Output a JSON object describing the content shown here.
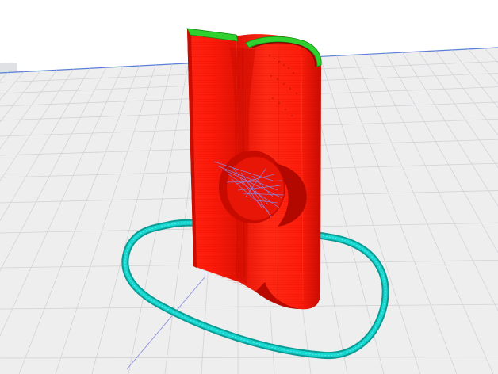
{
  "viewport": {
    "description_label": "",
    "colors": {
      "background": "#ffffff",
      "build_plate": "#eeeeef",
      "grid_line": "#d2d3d6",
      "plate_edge": "#5a7fd6",
      "axis_line": "#8a90e0",
      "model_wall": "#ff1a0a",
      "model_shadow": "#d40e00",
      "model_highlight": "#ff4a36",
      "top_layer": "#2ed12e",
      "travel_moves": "#8a8ff0",
      "skirt": "#16d7cf",
      "skirt_dark": "#0c9a94"
    },
    "objects": [
      {
        "name": "build-plate",
        "kind": "grid"
      },
      {
        "name": "skirt-outline",
        "kind": "brim"
      },
      {
        "name": "sliced-model",
        "kind": "layer-preview"
      },
      {
        "name": "travel-paths",
        "kind": "travel"
      }
    ]
  }
}
